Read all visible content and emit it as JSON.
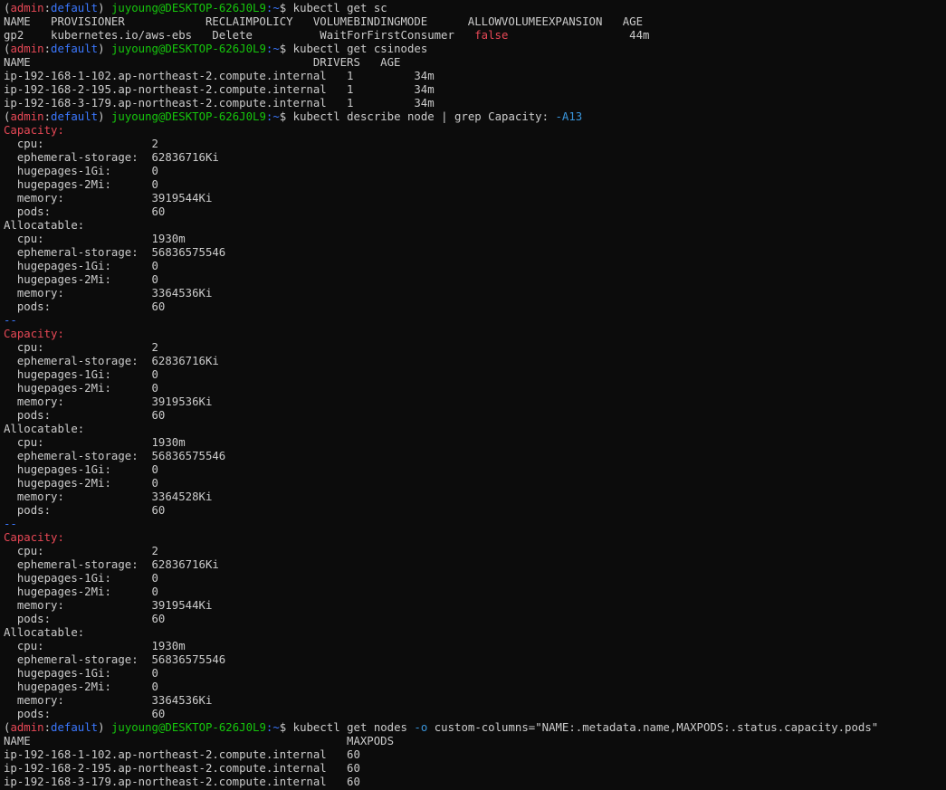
{
  "window": {
    "background": "#0c0c0c",
    "foreground": "#cccccc"
  },
  "colors": {
    "prompt_context_user": "#e74856",
    "prompt_context_ns": "#3b78ff",
    "prompt_userhost": "#16c60c",
    "prompt_cwd": "#3b78ff",
    "flag": "#3a96dd",
    "highlight_red": "#e74856"
  },
  "lines": [
    {
      "segments": [
        {
          "t": "(",
          "c": "paren"
        },
        {
          "t": "admin",
          "c": "ctx-user"
        },
        {
          "t": ":",
          "c": "paren"
        },
        {
          "t": "default",
          "c": "ctx-ns"
        },
        {
          "t": ") ",
          "c": "paren"
        },
        {
          "t": "juyoung@DESKTOP-626J0L9",
          "c": "user-host"
        },
        {
          "t": ":~",
          "c": "cwd"
        },
        {
          "t": "$ ",
          "c": "dollar"
        },
        {
          "t": "kubectl get sc",
          "c": "cmd"
        }
      ]
    },
    {
      "segments": [
        {
          "t": "NAME   PROVISIONER            RECLAIMPOLICY   VOLUMEBINDINGMODE      ALLOWVOLUMEEXPANSION   AGE",
          "c": "plain"
        }
      ]
    },
    {
      "segments": [
        {
          "t": "gp2    kubernetes.io/aws-ebs   Delete          WaitForFirstConsumer   ",
          "c": "plain"
        },
        {
          "t": "false",
          "c": "red"
        },
        {
          "t": "                  44m",
          "c": "plain"
        }
      ]
    },
    {
      "segments": [
        {
          "t": "(",
          "c": "paren"
        },
        {
          "t": "admin",
          "c": "ctx-user"
        },
        {
          "t": ":",
          "c": "paren"
        },
        {
          "t": "default",
          "c": "ctx-ns"
        },
        {
          "t": ") ",
          "c": "paren"
        },
        {
          "t": "juyoung@DESKTOP-626J0L9",
          "c": "user-host"
        },
        {
          "t": ":~",
          "c": "cwd"
        },
        {
          "t": "$ ",
          "c": "dollar"
        },
        {
          "t": "kubectl get csinodes",
          "c": "cmd"
        }
      ]
    },
    {
      "segments": [
        {
          "t": "NAME                                          DRIVERS   AGE",
          "c": "plain"
        }
      ]
    },
    {
      "segments": [
        {
          "t": "ip-192-168-1-102.ap-northeast-2.compute.internal   1         34m",
          "c": "plain"
        }
      ]
    },
    {
      "segments": [
        {
          "t": "ip-192-168-2-195.ap-northeast-2.compute.internal   1         34m",
          "c": "plain"
        }
      ]
    },
    {
      "segments": [
        {
          "t": "ip-192-168-3-179.ap-northeast-2.compute.internal   1         34m",
          "c": "plain"
        }
      ]
    },
    {
      "segments": [
        {
          "t": "(",
          "c": "paren"
        },
        {
          "t": "admin",
          "c": "ctx-user"
        },
        {
          "t": ":",
          "c": "paren"
        },
        {
          "t": "default",
          "c": "ctx-ns"
        },
        {
          "t": ") ",
          "c": "paren"
        },
        {
          "t": "juyoung@DESKTOP-626J0L9",
          "c": "user-host"
        },
        {
          "t": ":~",
          "c": "cwd"
        },
        {
          "t": "$ ",
          "c": "dollar"
        },
        {
          "t": "kubectl describe node | grep Capacity: ",
          "c": "cmd"
        },
        {
          "t": "-A13",
          "c": "flag"
        }
      ]
    },
    {
      "segments": [
        {
          "t": "Capacity:",
          "c": "red"
        }
      ]
    },
    {
      "segments": [
        {
          "t": "  cpu:                2",
          "c": "plain"
        }
      ]
    },
    {
      "segments": [
        {
          "t": "  ephemeral-storage:  62836716Ki",
          "c": "plain"
        }
      ]
    },
    {
      "segments": [
        {
          "t": "  hugepages-1Gi:      0",
          "c": "plain"
        }
      ]
    },
    {
      "segments": [
        {
          "t": "  hugepages-2Mi:      0",
          "c": "plain"
        }
      ]
    },
    {
      "segments": [
        {
          "t": "  memory:             3919544Ki",
          "c": "plain"
        }
      ]
    },
    {
      "segments": [
        {
          "t": "  pods:               60",
          "c": "plain"
        }
      ]
    },
    {
      "segments": [
        {
          "t": "Allocatable:",
          "c": "plain"
        }
      ]
    },
    {
      "segments": [
        {
          "t": "  cpu:                1930m",
          "c": "plain"
        }
      ]
    },
    {
      "segments": [
        {
          "t": "  ephemeral-storage:  56836575546",
          "c": "plain"
        }
      ]
    },
    {
      "segments": [
        {
          "t": "  hugepages-1Gi:      0",
          "c": "plain"
        }
      ]
    },
    {
      "segments": [
        {
          "t": "  hugepages-2Mi:      0",
          "c": "plain"
        }
      ]
    },
    {
      "segments": [
        {
          "t": "  memory:             3364536Ki",
          "c": "plain"
        }
      ]
    },
    {
      "segments": [
        {
          "t": "  pods:               60",
          "c": "plain"
        }
      ]
    },
    {
      "segments": [
        {
          "t": "--",
          "c": "sep"
        }
      ]
    },
    {
      "segments": [
        {
          "t": "Capacity:",
          "c": "red"
        }
      ]
    },
    {
      "segments": [
        {
          "t": "  cpu:                2",
          "c": "plain"
        }
      ]
    },
    {
      "segments": [
        {
          "t": "  ephemeral-storage:  62836716Ki",
          "c": "plain"
        }
      ]
    },
    {
      "segments": [
        {
          "t": "  hugepages-1Gi:      0",
          "c": "plain"
        }
      ]
    },
    {
      "segments": [
        {
          "t": "  hugepages-2Mi:      0",
          "c": "plain"
        }
      ]
    },
    {
      "segments": [
        {
          "t": "  memory:             3919536Ki",
          "c": "plain"
        }
      ]
    },
    {
      "segments": [
        {
          "t": "  pods:               60",
          "c": "plain"
        }
      ]
    },
    {
      "segments": [
        {
          "t": "Allocatable:",
          "c": "plain"
        }
      ]
    },
    {
      "segments": [
        {
          "t": "  cpu:                1930m",
          "c": "plain"
        }
      ]
    },
    {
      "segments": [
        {
          "t": "  ephemeral-storage:  56836575546",
          "c": "plain"
        }
      ]
    },
    {
      "segments": [
        {
          "t": "  hugepages-1Gi:      0",
          "c": "plain"
        }
      ]
    },
    {
      "segments": [
        {
          "t": "  hugepages-2Mi:      0",
          "c": "plain"
        }
      ]
    },
    {
      "segments": [
        {
          "t": "  memory:             3364528Ki",
          "c": "plain"
        }
      ]
    },
    {
      "segments": [
        {
          "t": "  pods:               60",
          "c": "plain"
        }
      ]
    },
    {
      "segments": [
        {
          "t": "--",
          "c": "sep"
        }
      ]
    },
    {
      "segments": [
        {
          "t": "Capacity:",
          "c": "red"
        }
      ]
    },
    {
      "segments": [
        {
          "t": "  cpu:                2",
          "c": "plain"
        }
      ]
    },
    {
      "segments": [
        {
          "t": "  ephemeral-storage:  62836716Ki",
          "c": "plain"
        }
      ]
    },
    {
      "segments": [
        {
          "t": "  hugepages-1Gi:      0",
          "c": "plain"
        }
      ]
    },
    {
      "segments": [
        {
          "t": "  hugepages-2Mi:      0",
          "c": "plain"
        }
      ]
    },
    {
      "segments": [
        {
          "t": "  memory:             3919544Ki",
          "c": "plain"
        }
      ]
    },
    {
      "segments": [
        {
          "t": "  pods:               60",
          "c": "plain"
        }
      ]
    },
    {
      "segments": [
        {
          "t": "Allocatable:",
          "c": "plain"
        }
      ]
    },
    {
      "segments": [
        {
          "t": "  cpu:                1930m",
          "c": "plain"
        }
      ]
    },
    {
      "segments": [
        {
          "t": "  ephemeral-storage:  56836575546",
          "c": "plain"
        }
      ]
    },
    {
      "segments": [
        {
          "t": "  hugepages-1Gi:      0",
          "c": "plain"
        }
      ]
    },
    {
      "segments": [
        {
          "t": "  hugepages-2Mi:      0",
          "c": "plain"
        }
      ]
    },
    {
      "segments": [
        {
          "t": "  memory:             3364536Ki",
          "c": "plain"
        }
      ]
    },
    {
      "segments": [
        {
          "t": "  pods:               60",
          "c": "plain"
        }
      ]
    },
    {
      "segments": [
        {
          "t": "(",
          "c": "paren"
        },
        {
          "t": "admin",
          "c": "ctx-user"
        },
        {
          "t": ":",
          "c": "paren"
        },
        {
          "t": "default",
          "c": "ctx-ns"
        },
        {
          "t": ") ",
          "c": "paren"
        },
        {
          "t": "juyoung@DESKTOP-626J0L9",
          "c": "user-host"
        },
        {
          "t": ":~",
          "c": "cwd"
        },
        {
          "t": "$ ",
          "c": "dollar"
        },
        {
          "t": "kubectl get nodes ",
          "c": "cmd"
        },
        {
          "t": "-o",
          "c": "flag"
        },
        {
          "t": " custom-columns=\"NAME:.metadata.name,MAXPODS:.status.capacity.pods\"",
          "c": "cmd"
        }
      ]
    },
    {
      "segments": [
        {
          "t": "NAME                                               MAXPODS",
          "c": "plain"
        }
      ]
    },
    {
      "segments": [
        {
          "t": "ip-192-168-1-102.ap-northeast-2.compute.internal   60",
          "c": "plain"
        }
      ]
    },
    {
      "segments": [
        {
          "t": "ip-192-168-2-195.ap-northeast-2.compute.internal   60",
          "c": "plain"
        }
      ]
    },
    {
      "segments": [
        {
          "t": "ip-192-168-3-179.ap-northeast-2.compute.internal   60",
          "c": "plain"
        }
      ]
    }
  ]
}
